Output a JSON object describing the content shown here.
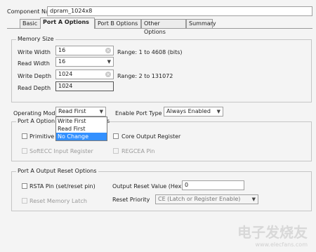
{
  "component": {
    "label": "Component Name",
    "value": "dpram_1024x8"
  },
  "tabs": [
    {
      "label": "Basic"
    },
    {
      "label": "Port A Options"
    },
    {
      "label": "Port B Options"
    },
    {
      "label": "Other Options"
    },
    {
      "label": "Summary"
    }
  ],
  "memory_size": {
    "title": "Memory Size",
    "write_width": {
      "label": "Write Width",
      "value": "16",
      "range": "Range: 1 to 4608 (bits)"
    },
    "read_width": {
      "label": "Read Width",
      "value": "16"
    },
    "write_depth": {
      "label": "Write Depth",
      "value": "1024",
      "range": "Range: 2 to 131072"
    },
    "read_depth": {
      "label": "Read Depth",
      "value": "1024"
    }
  },
  "operating_mode": {
    "label": "Operating Mode",
    "value": "Read First",
    "options": [
      "Write First",
      "Read First",
      "No Change"
    ],
    "highlighted": "No Change"
  },
  "enable_port_type": {
    "label": "Enable Port Type",
    "value": "Always Enabled"
  },
  "port_a_optional": {
    "title_left": "Port A Option",
    "title_right": "s",
    "primitives": "Primitive",
    "core_output": "Core Output Register",
    "softecc": "SoftECC Input Register",
    "regcea": "REGCEA Pin"
  },
  "port_a_reset": {
    "title": "Port A Output Reset Options",
    "rsta": "RSTA Pin (set/reset pin)",
    "output_reset_label": "Output Reset Value (Hex)",
    "output_reset_value": "0",
    "reset_memory_latch": "Reset Memory Latch",
    "reset_priority_label": "Reset Priority",
    "reset_priority_value": "CE (Latch or Register Enable)"
  },
  "watermark": "电子发烧友",
  "watermark_sub": "www.elecfans.com"
}
